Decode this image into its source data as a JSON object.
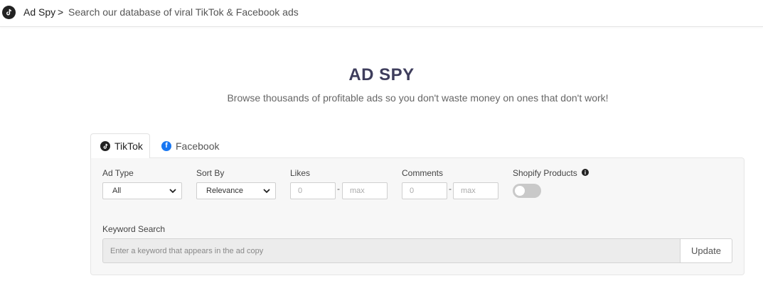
{
  "topbar": {
    "logo_icon": "tiktok-icon",
    "crumb_root": "Ad Spy",
    "crumb_sep": ">",
    "crumb_desc": "Search our database of viral TikTok & Facebook ads"
  },
  "hero": {
    "title": "AD SPY",
    "subtitle": "Browse thousands of profitable ads so you don't waste money on ones that don't work!"
  },
  "tabs": [
    {
      "label": "TikTok",
      "icon": "tiktok-icon",
      "active": true
    },
    {
      "label": "Facebook",
      "icon": "facebook-icon",
      "active": false
    }
  ],
  "filters": {
    "ad_type": {
      "label": "Ad Type",
      "value": "All"
    },
    "sort_by": {
      "label": "Sort By",
      "value": "Relevance"
    },
    "likes": {
      "label": "Likes",
      "min_placeholder": "0",
      "max_placeholder": "max",
      "dash": "-"
    },
    "comments": {
      "label": "Comments",
      "min_placeholder": "0",
      "max_placeholder": "max",
      "dash": "-"
    },
    "shopify": {
      "label": "Shopify Products",
      "info": "i",
      "enabled": false
    }
  },
  "keyword": {
    "label": "Keyword Search",
    "placeholder": "Enter a keyword that appears in the ad copy",
    "button": "Update"
  },
  "colors": {
    "title": "#3e3d5c",
    "facebook": "#1877f2",
    "toggle_off": "#c9c9c9"
  }
}
